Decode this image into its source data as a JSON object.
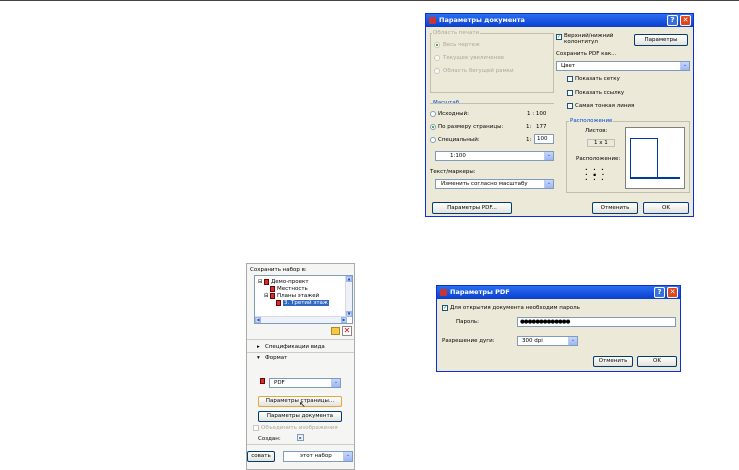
{
  "doc_dialog": {
    "title": "Параметры документа",
    "print_area": {
      "label": "Область печати",
      "options": [
        "Весь чертеж",
        "Текущее увеличение",
        "Область бегущей рамки"
      ]
    },
    "header_footer_label": "Верхний/нижний колонтитул",
    "params_button": "Параметры",
    "save_pdf_label": "Сохранить PDF как...",
    "save_pdf_value": "Цвет",
    "checks": [
      "Показать сетку",
      "Показать ссылку",
      "Самая тонкая линия"
    ],
    "scale": {
      "label": "Масштаб",
      "original_label": "Исходный:",
      "original_value": "1 : 100",
      "fit_label": "По размеру страницы:",
      "fit_prefix": "1:",
      "fit_value": "177",
      "custom_label": "Специальный:",
      "custom_prefix": "1:",
      "custom_value": "100",
      "combo_value": "1:100"
    },
    "text_markers_label": "Текст/маркеры:",
    "text_markers_value": "Изменить согласно масштабу",
    "placement": {
      "label": "Расположение",
      "sheets_label": "Листов:",
      "sheets_value": "1 x 1",
      "position_label": "Расположение:"
    },
    "pdf_params_button": "Параметры PDF...",
    "cancel_button": "Отменить",
    "ok_button": "OK"
  },
  "side_panel": {
    "save_set_label": "Сохранить набор в:",
    "tree": [
      "Демо-проект",
      "Местность",
      "Планы этажей",
      "3. Третий этаж"
    ],
    "view_specs": "Спецификации вида",
    "format": "Формат",
    "format_value": "PDF",
    "page_params_button": "Параметры страницы...",
    "doc_params_button": "Параметры документа",
    "merge_images": "Объединить изображения",
    "create_label": "Создан:",
    "bottom_left_button": "совать",
    "bottom_combo_value": "этот набор"
  },
  "pdf_dialog": {
    "title": "Параметры PDF",
    "password_check_label": "Для открытия документа необходим пароль",
    "password_label": "Пароль:",
    "password_value": "●●●●●●●●●●●●●",
    "resolution_label": "Разрешение дуги:",
    "resolution_value": "300 dpi",
    "cancel_button": "Отменить",
    "ok_button": "OK"
  }
}
